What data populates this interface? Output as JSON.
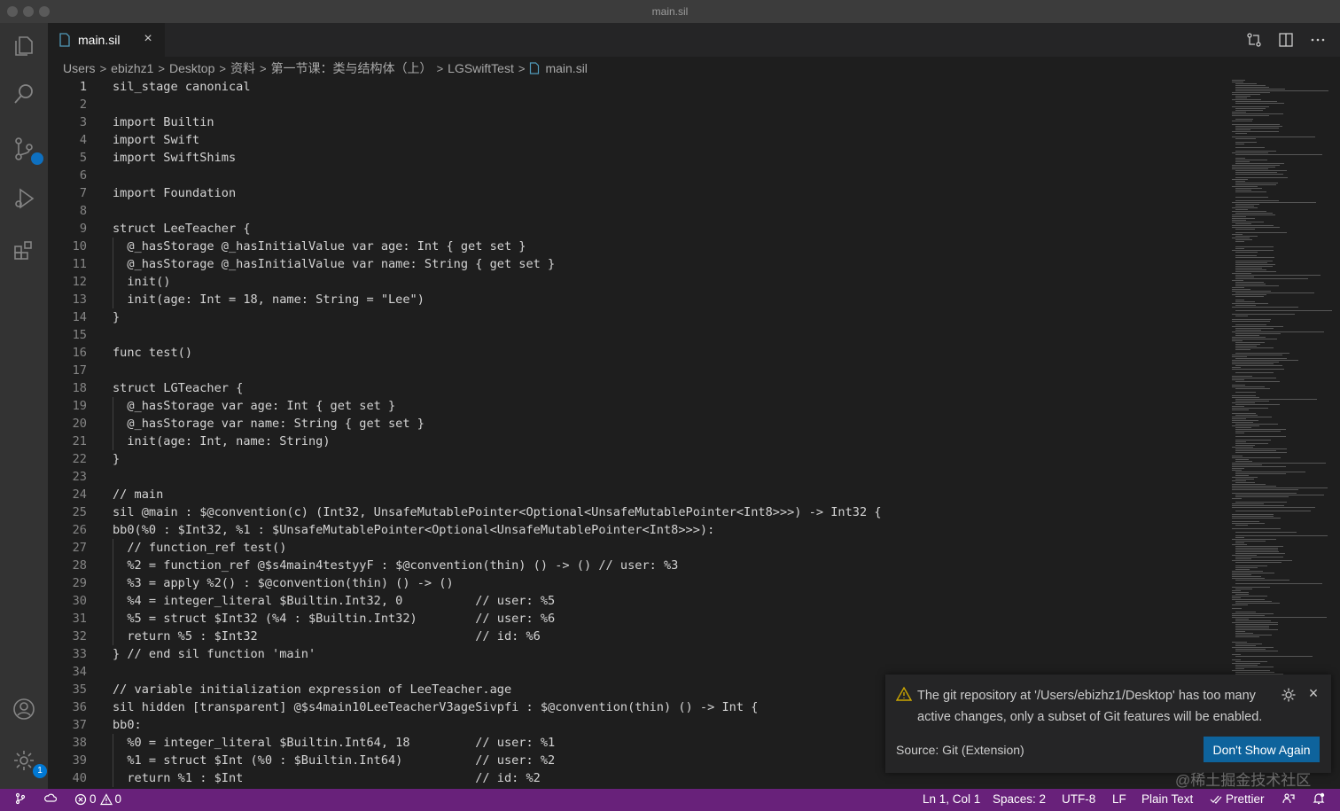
{
  "window": {
    "title": "main.sil"
  },
  "tab": {
    "label": "main.sil",
    "close": "×"
  },
  "breadcrumb": [
    "Users",
    "ebizhz1",
    "Desktop",
    "资料",
    "第一节课：类与结构体（上）",
    "LGSwiftTest",
    "main.sil"
  ],
  "breadcrumb_sep": ">",
  "activity": {
    "scm_badge": "1"
  },
  "colors": {
    "statusbar": "#68217a",
    "accent_button": "#0e639c",
    "editor_bg": "#1e1e1e",
    "warning": "#cca700"
  },
  "code_lines": [
    {
      "n": "1",
      "t": "sil_stage canonical"
    },
    {
      "n": "2",
      "t": ""
    },
    {
      "n": "3",
      "t": "import Builtin"
    },
    {
      "n": "4",
      "t": "import Swift"
    },
    {
      "n": "5",
      "t": "import SwiftShims"
    },
    {
      "n": "6",
      "t": ""
    },
    {
      "n": "7",
      "t": "import Foundation"
    },
    {
      "n": "8",
      "t": ""
    },
    {
      "n": "9",
      "t": "struct LeeTeacher {"
    },
    {
      "n": "10",
      "t": "  @_hasStorage @_hasInitialValue var age: Int { get set }"
    },
    {
      "n": "11",
      "t": "  @_hasStorage @_hasInitialValue var name: String { get set }"
    },
    {
      "n": "12",
      "t": "  init()"
    },
    {
      "n": "13",
      "t": "  init(age: Int = 18, name: String = \"Lee\")"
    },
    {
      "n": "14",
      "t": "}"
    },
    {
      "n": "15",
      "t": ""
    },
    {
      "n": "16",
      "t": "func test()"
    },
    {
      "n": "17",
      "t": ""
    },
    {
      "n": "18",
      "t": "struct LGTeacher {"
    },
    {
      "n": "19",
      "t": "  @_hasStorage var age: Int { get set }"
    },
    {
      "n": "20",
      "t": "  @_hasStorage var name: String { get set }"
    },
    {
      "n": "21",
      "t": "  init(age: Int, name: String)"
    },
    {
      "n": "22",
      "t": "}"
    },
    {
      "n": "23",
      "t": ""
    },
    {
      "n": "24",
      "t": "// main"
    },
    {
      "n": "25",
      "t": "sil @main : $@convention(c) (Int32, UnsafeMutablePointer<Optional<UnsafeMutablePointer<Int8>>>) -> Int32 {"
    },
    {
      "n": "26",
      "t": "bb0(%0 : $Int32, %1 : $UnsafeMutablePointer<Optional<UnsafeMutablePointer<Int8>>>):"
    },
    {
      "n": "27",
      "t": "  // function_ref test()"
    },
    {
      "n": "28",
      "t": "  %2 = function_ref @$s4main4testyyF : $@convention(thin) () -> () // user: %3"
    },
    {
      "n": "29",
      "t": "  %3 = apply %2() : $@convention(thin) () -> ()"
    },
    {
      "n": "30",
      "t": "  %4 = integer_literal $Builtin.Int32, 0          // user: %5"
    },
    {
      "n": "31",
      "t": "  %5 = struct $Int32 (%4 : $Builtin.Int32)        // user: %6"
    },
    {
      "n": "32",
      "t": "  return %5 : $Int32                              // id: %6"
    },
    {
      "n": "33",
      "t": "} // end sil function 'main'"
    },
    {
      "n": "34",
      "t": ""
    },
    {
      "n": "35",
      "t": "// variable initialization expression of LeeTeacher.age"
    },
    {
      "n": "36",
      "t": "sil hidden [transparent] @$s4main10LeeTeacherV3ageSivpfi : $@convention(thin) () -> Int {"
    },
    {
      "n": "37",
      "t": "bb0:"
    },
    {
      "n": "38",
      "t": "  %0 = integer_literal $Builtin.Int64, 18         // user: %1"
    },
    {
      "n": "39",
      "t": "  %1 = struct $Int (%0 : $Builtin.Int64)          // user: %2"
    },
    {
      "n": "40",
      "t": "  return %1 : $Int                                // id: %2"
    }
  ],
  "notification": {
    "message": "The git repository at '/Users/ebizhz1/Desktop' has too many active changes, only a subset of Git features will be enabled.",
    "source": "Source: Git (Extension)",
    "button": "Don't Show Again",
    "close": "×"
  },
  "statusbar": {
    "errors": "0",
    "warnings": "0",
    "position": "Ln 1, Col 1",
    "spaces": "Spaces: 2",
    "encoding": "UTF-8",
    "eol": "LF",
    "language": "Plain Text",
    "formatter": "Prettier"
  },
  "watermark": "@稀土掘金技术社区"
}
